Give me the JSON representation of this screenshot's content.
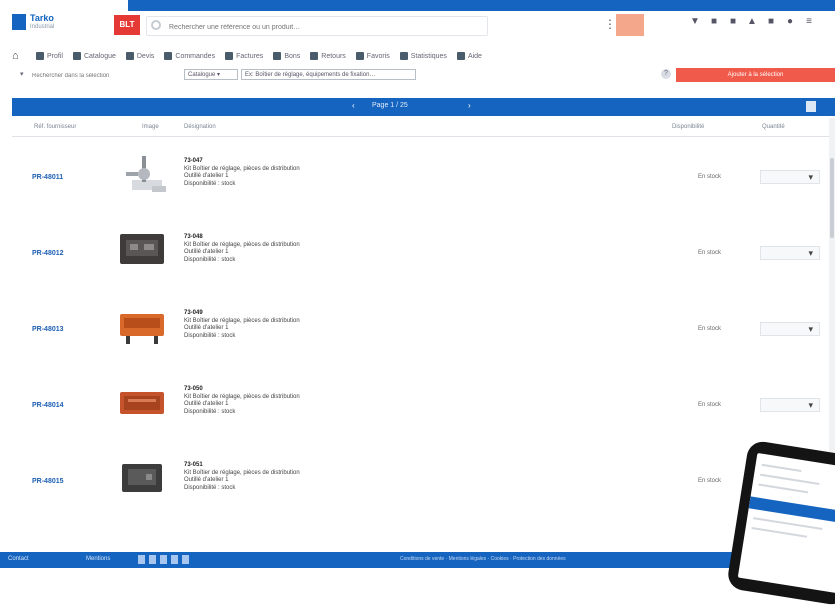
{
  "header": {
    "logo_title": "Tarko",
    "logo_sub": "Industrial",
    "red_badge": "BLT",
    "search_placeholder": "Rechercher une référence ou un produit…",
    "icons": [
      "cart-icon",
      "doc-icon",
      "print-icon",
      "flag-icon",
      "lock-icon",
      "user-icon",
      "menu-icon"
    ]
  },
  "nav": {
    "items": [
      "Profil",
      "Catalogue",
      "Devis",
      "Commandes",
      "Factures",
      "Bons",
      "Retours",
      "Favoris",
      "Statistiques",
      "Aide"
    ]
  },
  "filters": {
    "search_placeholder": "Rechercher dans la sélection",
    "select_1": "Catalogue ▾",
    "select_2": "Ex: Boîtier de réglage, équipements de fixation…",
    "red_button": "Ajouter à la sélection"
  },
  "pager": {
    "prev": "‹",
    "text": "Page 1 / 25",
    "next": "›"
  },
  "table": {
    "headers": [
      "Réf. fournisseur",
      "Image",
      "Désignation",
      "Disponibilité",
      "Quantité"
    ],
    "rows": [
      {
        "ref": "PR-48011",
        "title": "73-047",
        "line1": "Kit Boîtier de réglage, pièces de distribution",
        "line2": "Outillé d'atelier 1",
        "line3": "Disponibilité : stock",
        "stock": "En stock"
      },
      {
        "ref": "PR-48012",
        "title": "73-048",
        "line1": "Kit Boîtier de réglage, pièces de distribution",
        "line2": "Outillé d'atelier 1",
        "line3": "Disponibilité : stock",
        "stock": "En stock"
      },
      {
        "ref": "PR-48013",
        "title": "73-049",
        "line1": "Kit Boîtier de réglage, pièces de distribution",
        "line2": "Outillé d'atelier 1",
        "line3": "Disponibilité : stock",
        "stock": "En stock"
      },
      {
        "ref": "PR-48014",
        "title": "73-050",
        "line1": "Kit Boîtier de réglage, pièces de distribution",
        "line2": "Outillé d'atelier 1",
        "line3": "Disponibilité : stock",
        "stock": "En stock"
      },
      {
        "ref": "PR-48015",
        "title": "73-051",
        "line1": "Kit Boîtier de réglage, pièces de distribution",
        "line2": "Outillé d'atelier 1",
        "line3": "Disponibilité : stock",
        "stock": "En stock"
      }
    ]
  },
  "footer": {
    "left1": "Contact",
    "left2": "Mentions",
    "right": "Conditions de vente · Mentions légales · Cookies · Protection des données"
  },
  "colors": {
    "primary": "#1565c0",
    "accent_red": "#f05a4a",
    "orange_box": "#f4a78a"
  }
}
